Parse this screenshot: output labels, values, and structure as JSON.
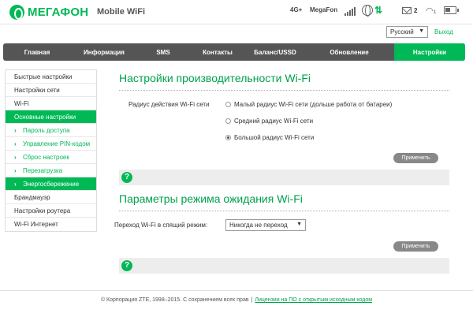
{
  "header": {
    "brand": "МЕГАФОН",
    "product": "Mobile WiFi",
    "network_type": "4G+",
    "operator": "MegaFon",
    "signal_bars": 5,
    "sms_count": "2",
    "wifi_clients": "1",
    "icons": [
      "megafon-logo",
      "signal-icon",
      "globe-icon",
      "data-arrows-icon",
      "mail-icon",
      "wifi-icon",
      "battery-icon"
    ]
  },
  "language": {
    "selected": "Русский",
    "exit_label": "Выход"
  },
  "topnav": {
    "tabs": [
      "Главная",
      "Информация",
      "SMS",
      "Контакты",
      "Баланс/USSD",
      "Обновление",
      "Настройки"
    ],
    "active_index": 6
  },
  "sidebar": {
    "items": [
      "Быстрые настройки",
      "Настройки сети",
      "Wi-Fi",
      "Основные настройки",
      "Пароль доступа",
      "Управление PIN-кодом",
      "Сброс настроек",
      "Перезагрузка",
      "Энергосбережение",
      "Брандмауэр",
      "Настройки роутера",
      "Wi-Fi  Интернет"
    ]
  },
  "section1": {
    "title": "Настройки производительности Wi-Fi",
    "radius_label": "Радиус действия Wi-Fi сети",
    "options": [
      "Малый радиус Wi-Fi сети (дольше работа от батареи)",
      "Средний радиус Wi-Fi сети",
      "Большой радиус Wi-Fi сети"
    ],
    "selected_index": 2,
    "apply_label": "Применить",
    "help": "?"
  },
  "section2": {
    "title": "Параметры режима ожидания Wi-Fi",
    "sleep_label": "Переход Wi-Fi в спящий режим:",
    "sleep_value": "Никогда не переход",
    "apply_label": "Применить",
    "help": "?"
  },
  "footer": {
    "copyright": "© Корпорация ZTE, 1998–2015. С сохранением всех прав",
    "separator": "|",
    "license_link": "Лицензии на ПО с открытым исходным кодом"
  },
  "colors": {
    "brand_green": "#00b956",
    "nav_gray": "#555555",
    "button_gray": "#888888"
  }
}
